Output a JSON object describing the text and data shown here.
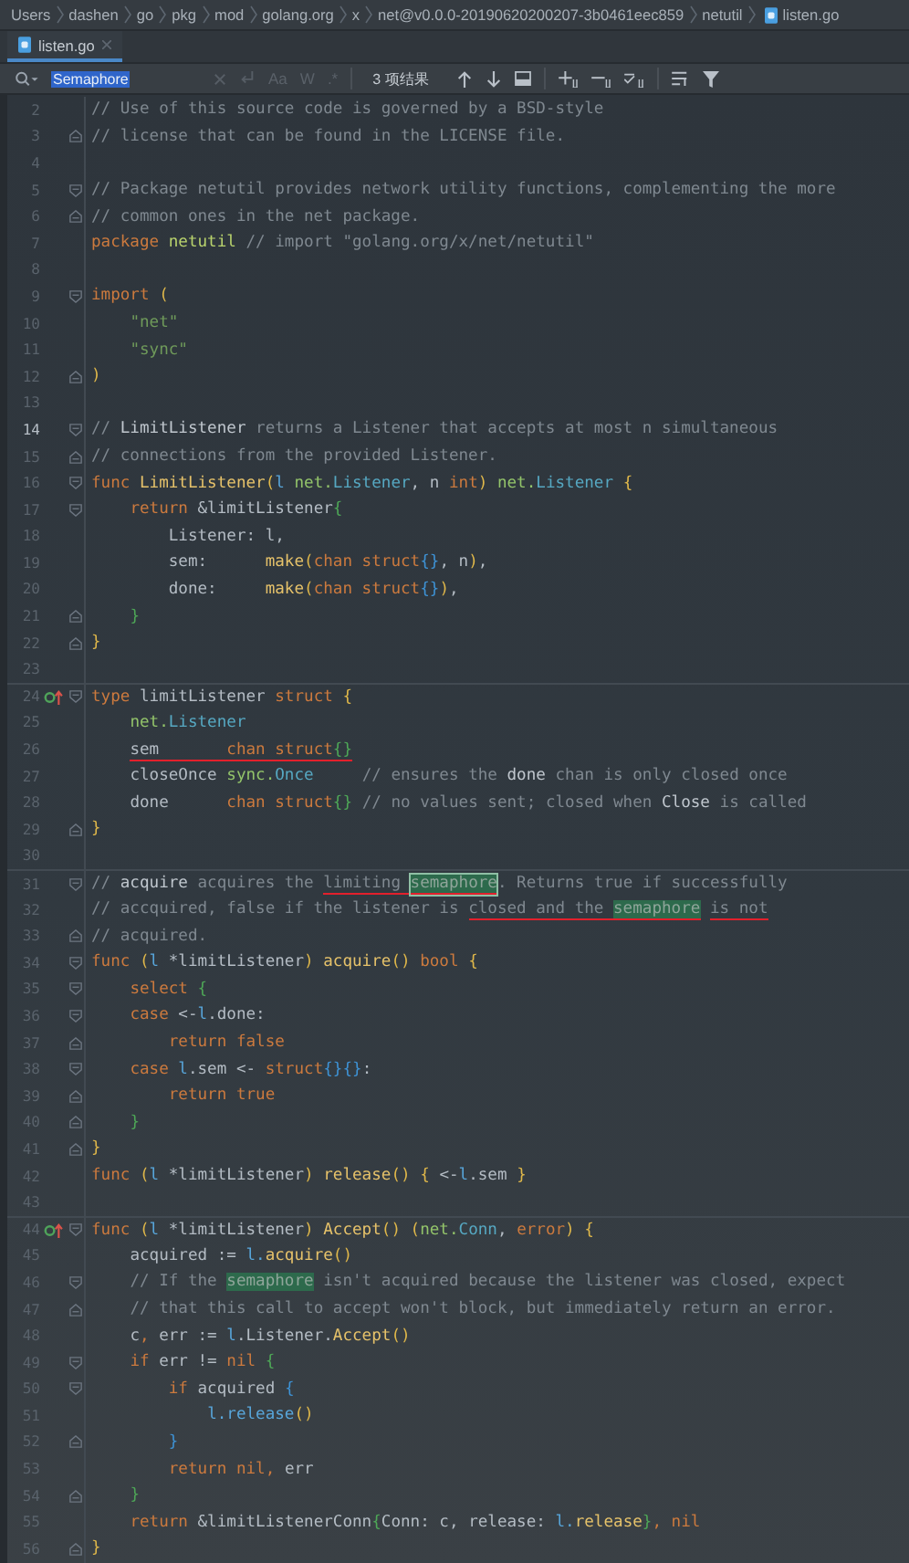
{
  "breadcrumb": [
    {
      "label": "Users"
    },
    {
      "label": "dashen"
    },
    {
      "label": "go"
    },
    {
      "label": "pkg"
    },
    {
      "label": "mod"
    },
    {
      "label": "golang.org"
    },
    {
      "label": "x"
    },
    {
      "label": "net@v0.0.0-20190620200207-3b0461eec859"
    },
    {
      "label": "netutil"
    },
    {
      "label": "listen.go"
    }
  ],
  "tabs": [
    {
      "label": "listen.go",
      "selected": true
    }
  ],
  "search": {
    "value": "Semaphore",
    "value_selected": true,
    "options": [
      {
        "label": "Aa",
        "selected": false
      },
      {
        "label": "W",
        "selected": false
      },
      {
        "label": ".*",
        "selected": false
      }
    ],
    "result_count": "3 项结果"
  },
  "lines": [
    {
      "number": "2",
      "tokens": [
        {
          "kind": "comment",
          "text": "// Use of this source code is governed by a BSD-style"
        }
      ]
    },
    {
      "number": "3",
      "fold_end": true,
      "tokens": [
        {
          "kind": "comment",
          "text": "// license that can be found in the LICENSE file."
        }
      ]
    },
    {
      "number": "4"
    },
    {
      "number": "5",
      "fold_start": true,
      "tokens": [
        {
          "kind": "comment",
          "text": "// Package netutil provides network utility functions, complementing the more"
        }
      ]
    },
    {
      "number": "6",
      "fold_end": true,
      "tokens": [
        {
          "kind": "comment",
          "text": "// common ones in the net package."
        }
      ]
    },
    {
      "number": "7",
      "tokens": [
        {
          "kind": "keyword",
          "text": "package "
        },
        {
          "kind": "pkgname",
          "text": "netutil"
        },
        {
          "kind": "comment",
          "text": " // import \"golang.org/x/net/netutil\""
        }
      ]
    },
    {
      "number": "8"
    },
    {
      "number": "9",
      "fold_start": true,
      "tokens": [
        {
          "kind": "keyword",
          "text": "import "
        },
        {
          "kind": "brace1",
          "text": "("
        }
      ]
    },
    {
      "number": "10",
      "tokens": [
        {
          "kind": "string",
          "text": "    \"net\""
        }
      ]
    },
    {
      "number": "11",
      "tokens": [
        {
          "kind": "string",
          "text": "    \"sync\""
        }
      ]
    },
    {
      "number": "12",
      "fold_end": true,
      "tokens": [
        {
          "kind": "brace1",
          "text": ")"
        }
      ]
    },
    {
      "number": "13"
    },
    {
      "number": "14",
      "current": true,
      "fold_start": true,
      "tokens": [
        {
          "kind": "comment",
          "text": "// "
        },
        {
          "kind": "docref",
          "text": "LimitListener"
        },
        {
          "kind": "comment",
          "text": " returns a Listener that accepts at most n simultaneous"
        }
      ]
    },
    {
      "number": "15",
      "fold_end": true,
      "tokens": [
        {
          "kind": "comment",
          "text": "// connections from the provided Listener."
        }
      ]
    },
    {
      "number": "16",
      "fold_start": true,
      "tokens": [
        {
          "kind": "keyword",
          "text": "func "
        },
        {
          "kind": "function",
          "text": "LimitListener"
        },
        {
          "kind": "brace1",
          "text": "("
        },
        {
          "kind": "param",
          "text": "l "
        },
        {
          "kind": "pkg",
          "text": "net."
        },
        {
          "kind": "type",
          "text": "Listener"
        },
        {
          "kind": "plain",
          "text": ", n "
        },
        {
          "kind": "keyword",
          "text": "int"
        },
        {
          "kind": "brace1",
          "text": ") "
        },
        {
          "kind": "pkg",
          "text": "net."
        },
        {
          "kind": "type",
          "text": "Listener "
        },
        {
          "kind": "brace1",
          "text": "{"
        }
      ]
    },
    {
      "number": "17",
      "fold_start": true,
      "tokens": [
        {
          "kind": "keyword",
          "text": "    return "
        },
        {
          "kind": "plain",
          "text": "&limitListener"
        },
        {
          "kind": "brace2",
          "text": "{"
        }
      ]
    },
    {
      "number": "18",
      "tokens": [
        {
          "kind": "plain",
          "text": "        Listener: l,"
        }
      ]
    },
    {
      "number": "19",
      "tokens": [
        {
          "kind": "plain",
          "text": "        sem:      "
        },
        {
          "kind": "function",
          "text": "make"
        },
        {
          "kind": "brace1",
          "text": "("
        },
        {
          "kind": "keyword",
          "text": "chan struct"
        },
        {
          "kind": "brace3",
          "text": "{}"
        },
        {
          "kind": "plain",
          "text": ", n"
        },
        {
          "kind": "brace1",
          "text": ")"
        },
        {
          "kind": "plain",
          "text": ","
        }
      ]
    },
    {
      "number": "20",
      "tokens": [
        {
          "kind": "plain",
          "text": "        done:     "
        },
        {
          "kind": "function",
          "text": "make"
        },
        {
          "kind": "brace1",
          "text": "("
        },
        {
          "kind": "keyword",
          "text": "chan struct"
        },
        {
          "kind": "brace3",
          "text": "{}"
        },
        {
          "kind": "brace1",
          "text": ")"
        },
        {
          "kind": "plain",
          "text": ","
        }
      ]
    },
    {
      "number": "21",
      "fold_end": true,
      "tokens": [
        {
          "kind": "brace2",
          "text": "    }"
        }
      ]
    },
    {
      "number": "22",
      "fold_end": true,
      "tokens": [
        {
          "kind": "brace1",
          "text": "}"
        }
      ]
    },
    {
      "number": "23"
    },
    {
      "number": "24",
      "separator": true,
      "implemented": true,
      "fold_start": true,
      "tokens": [
        {
          "kind": "keyword",
          "text": "type "
        },
        {
          "kind": "plain",
          "text": "limitListener "
        },
        {
          "kind": "keyword",
          "text": "struct "
        },
        {
          "kind": "brace1",
          "text": "{"
        }
      ]
    },
    {
      "number": "25",
      "tokens": [
        {
          "kind": "pkg",
          "text": "    net."
        },
        {
          "kind": "type",
          "text": "Listener"
        }
      ]
    },
    {
      "number": "26",
      "tokens": [
        {
          "kind": "plain",
          "text": "    sem       ",
          "underline": true
        },
        {
          "kind": "keyword",
          "text": "chan struct",
          "underline": true
        },
        {
          "kind": "brace2",
          "text": "{}",
          "underline": true
        }
      ]
    },
    {
      "number": "27",
      "tokens": [
        {
          "kind": "plain",
          "text": "    closeOnce "
        },
        {
          "kind": "pkg",
          "text": "sync."
        },
        {
          "kind": "type",
          "text": "Once"
        },
        {
          "kind": "comment",
          "text": "     // ensures the "
        },
        {
          "kind": "docref",
          "text": "done"
        },
        {
          "kind": "comment",
          "text": " chan is only closed once"
        }
      ]
    },
    {
      "number": "28",
      "tokens": [
        {
          "kind": "plain",
          "text": "    done      "
        },
        {
          "kind": "keyword",
          "text": "chan struct"
        },
        {
          "kind": "brace2",
          "text": "{}"
        },
        {
          "kind": "comment",
          "text": " // no values sent; closed when "
        },
        {
          "kind": "docref",
          "text": "Close"
        },
        {
          "kind": "comment",
          "text": " is called"
        }
      ]
    },
    {
      "number": "29",
      "fold_end": true,
      "tokens": [
        {
          "kind": "brace1",
          "text": "}"
        }
      ]
    },
    {
      "number": "30"
    },
    {
      "number": "31",
      "separator": true,
      "fold_start": true,
      "tokens": [
        {
          "kind": "comment",
          "text": "// "
        },
        {
          "kind": "docref",
          "text": "acquire"
        },
        {
          "kind": "comment",
          "text": " acquires the "
        },
        {
          "kind": "comment",
          "text": "limiting ",
          "underline": true
        },
        {
          "kind": "match_active",
          "text": "semaphore",
          "underline": true
        },
        {
          "kind": "comment",
          "text": ". Returns true if successfully"
        }
      ]
    },
    {
      "number": "32",
      "tokens": [
        {
          "kind": "comment",
          "text": "// accquired, false if the listener is "
        },
        {
          "kind": "comment",
          "text": "closed and the ",
          "underline": true
        },
        {
          "kind": "match",
          "text": "semaphore",
          "underline": true
        },
        {
          "kind": "comment",
          "text": " is not",
          "underline": true
        }
      ]
    },
    {
      "number": "33",
      "fold_end": true,
      "tokens": [
        {
          "kind": "comment",
          "text": "// acquired."
        }
      ]
    },
    {
      "number": "34",
      "fold_start": true,
      "tokens": [
        {
          "kind": "keyword",
          "text": "func "
        },
        {
          "kind": "brace1",
          "text": "("
        },
        {
          "kind": "param",
          "text": "l "
        },
        {
          "kind": "plain",
          "text": "*limitListener"
        },
        {
          "kind": "brace1",
          "text": ") "
        },
        {
          "kind": "function",
          "text": "acquire"
        },
        {
          "kind": "brace1",
          "text": "() "
        },
        {
          "kind": "keyword",
          "text": "bool "
        },
        {
          "kind": "brace1",
          "text": "{"
        }
      ]
    },
    {
      "number": "35",
      "fold_start": true,
      "tokens": [
        {
          "kind": "keyword",
          "text": "    select "
        },
        {
          "kind": "brace2",
          "text": "{"
        }
      ]
    },
    {
      "number": "36",
      "fold_start": true,
      "tokens": [
        {
          "kind": "keyword",
          "text": "    case "
        },
        {
          "kind": "plain",
          "text": "<-"
        },
        {
          "kind": "param",
          "text": "l"
        },
        {
          "kind": "plain",
          "text": ".done:"
        }
      ]
    },
    {
      "number": "37",
      "fold_end": true,
      "tokens": [
        {
          "kind": "keyword",
          "text": "        return false"
        }
      ]
    },
    {
      "number": "38",
      "fold_start": true,
      "tokens": [
        {
          "kind": "keyword",
          "text": "    case "
        },
        {
          "kind": "param",
          "text": "l"
        },
        {
          "kind": "plain",
          "text": ".sem <- "
        },
        {
          "kind": "keyword",
          "text": "struct"
        },
        {
          "kind": "brace3",
          "text": "{}{}"
        },
        {
          "kind": "plain",
          "text": ":"
        }
      ]
    },
    {
      "number": "39",
      "fold_end": true,
      "tokens": [
        {
          "kind": "keyword",
          "text": "        return true"
        }
      ]
    },
    {
      "number": "40",
      "fold_end": true,
      "tokens": [
        {
          "kind": "brace2",
          "text": "    }"
        }
      ]
    },
    {
      "number": "41",
      "fold_end": true,
      "tokens": [
        {
          "kind": "brace1",
          "text": "}"
        }
      ]
    },
    {
      "number": "42",
      "tokens": [
        {
          "kind": "keyword",
          "text": "func "
        },
        {
          "kind": "brace1",
          "text": "("
        },
        {
          "kind": "param",
          "text": "l "
        },
        {
          "kind": "plain",
          "text": "*limitListener"
        },
        {
          "kind": "brace1",
          "text": ") "
        },
        {
          "kind": "function",
          "text": "release"
        },
        {
          "kind": "brace1",
          "text": "() {"
        },
        {
          "kind": "plain",
          "text": " <-"
        },
        {
          "kind": "param",
          "text": "l"
        },
        {
          "kind": "plain",
          "text": ".sem "
        },
        {
          "kind": "brace1",
          "text": "}"
        }
      ]
    },
    {
      "number": "43"
    },
    {
      "number": "44",
      "separator": true,
      "implemented": true,
      "fold_start": true,
      "tokens": [
        {
          "kind": "keyword",
          "text": "func "
        },
        {
          "kind": "brace1",
          "text": "("
        },
        {
          "kind": "param",
          "text": "l "
        },
        {
          "kind": "plain",
          "text": "*limitListener"
        },
        {
          "kind": "brace1",
          "text": ") "
        },
        {
          "kind": "function",
          "text": "Accept"
        },
        {
          "kind": "brace1",
          "text": "() ("
        },
        {
          "kind": "pkg",
          "text": "net."
        },
        {
          "kind": "type",
          "text": "Conn"
        },
        {
          "kind": "plain",
          "text": ", "
        },
        {
          "kind": "keyword",
          "text": "error"
        },
        {
          "kind": "brace1",
          "text": ") {"
        }
      ]
    },
    {
      "number": "45",
      "tokens": [
        {
          "kind": "plain",
          "text": "    acquired := "
        },
        {
          "kind": "param",
          "text": "l."
        },
        {
          "kind": "function",
          "text": "acquire"
        },
        {
          "kind": "brace1",
          "text": "()"
        }
      ]
    },
    {
      "number": "46",
      "fold_start": true,
      "tokens": [
        {
          "kind": "comment",
          "text": "    // If the "
        },
        {
          "kind": "match",
          "text": "semaphore"
        },
        {
          "kind": "comment",
          "text": " isn't acquired because the listener was closed, expect"
        }
      ]
    },
    {
      "number": "47",
      "fold_end": true,
      "tokens": [
        {
          "kind": "comment",
          "text": "    // that this call to accept won't block, but immediately return an error."
        }
      ]
    },
    {
      "number": "48",
      "tokens": [
        {
          "kind": "plain",
          "text": "    c"
        },
        {
          "kind": "keyword",
          "text": ","
        },
        {
          "kind": "plain",
          "text": " err := "
        },
        {
          "kind": "param",
          "text": "l"
        },
        {
          "kind": "plain",
          "text": ".Listener."
        },
        {
          "kind": "function",
          "text": "Accept"
        },
        {
          "kind": "brace1",
          "text": "()"
        }
      ]
    },
    {
      "number": "49",
      "fold_start": true,
      "tokens": [
        {
          "kind": "keyword",
          "text": "    if "
        },
        {
          "kind": "plain",
          "text": "err != "
        },
        {
          "kind": "keyword",
          "text": "nil "
        },
        {
          "kind": "brace2",
          "text": "{"
        }
      ]
    },
    {
      "number": "50",
      "fold_start": true,
      "tokens": [
        {
          "kind": "keyword",
          "text": "        if "
        },
        {
          "kind": "plain",
          "text": "acquired "
        },
        {
          "kind": "brace3",
          "text": "{"
        }
      ]
    },
    {
      "number": "51",
      "tokens": [
        {
          "kind": "param",
          "text": "            l.release"
        },
        {
          "kind": "brace1",
          "text": "()"
        }
      ]
    },
    {
      "number": "52",
      "fold_end": true,
      "tokens": [
        {
          "kind": "brace3",
          "text": "        }"
        }
      ]
    },
    {
      "number": "53",
      "tokens": [
        {
          "kind": "keyword",
          "text": "        return nil,"
        },
        {
          "kind": "plain",
          "text": " err"
        }
      ]
    },
    {
      "number": "54",
      "fold_end": true,
      "tokens": [
        {
          "kind": "brace2",
          "text": "    }"
        }
      ]
    },
    {
      "number": "55",
      "tokens": [
        {
          "kind": "keyword",
          "text": "    return "
        },
        {
          "kind": "plain",
          "text": "&limitListenerConn"
        },
        {
          "kind": "brace2",
          "text": "{"
        },
        {
          "kind": "plain",
          "text": "Conn: c, release: "
        },
        {
          "kind": "param",
          "text": "l."
        },
        {
          "kind": "function",
          "text": "release"
        },
        {
          "kind": "brace2",
          "text": "}"
        },
        {
          "kind": "keyword",
          "text": ", nil"
        }
      ]
    },
    {
      "number": "56",
      "fold_end": true,
      "tokens": [
        {
          "kind": "brace1",
          "text": "}"
        }
      ]
    }
  ]
}
